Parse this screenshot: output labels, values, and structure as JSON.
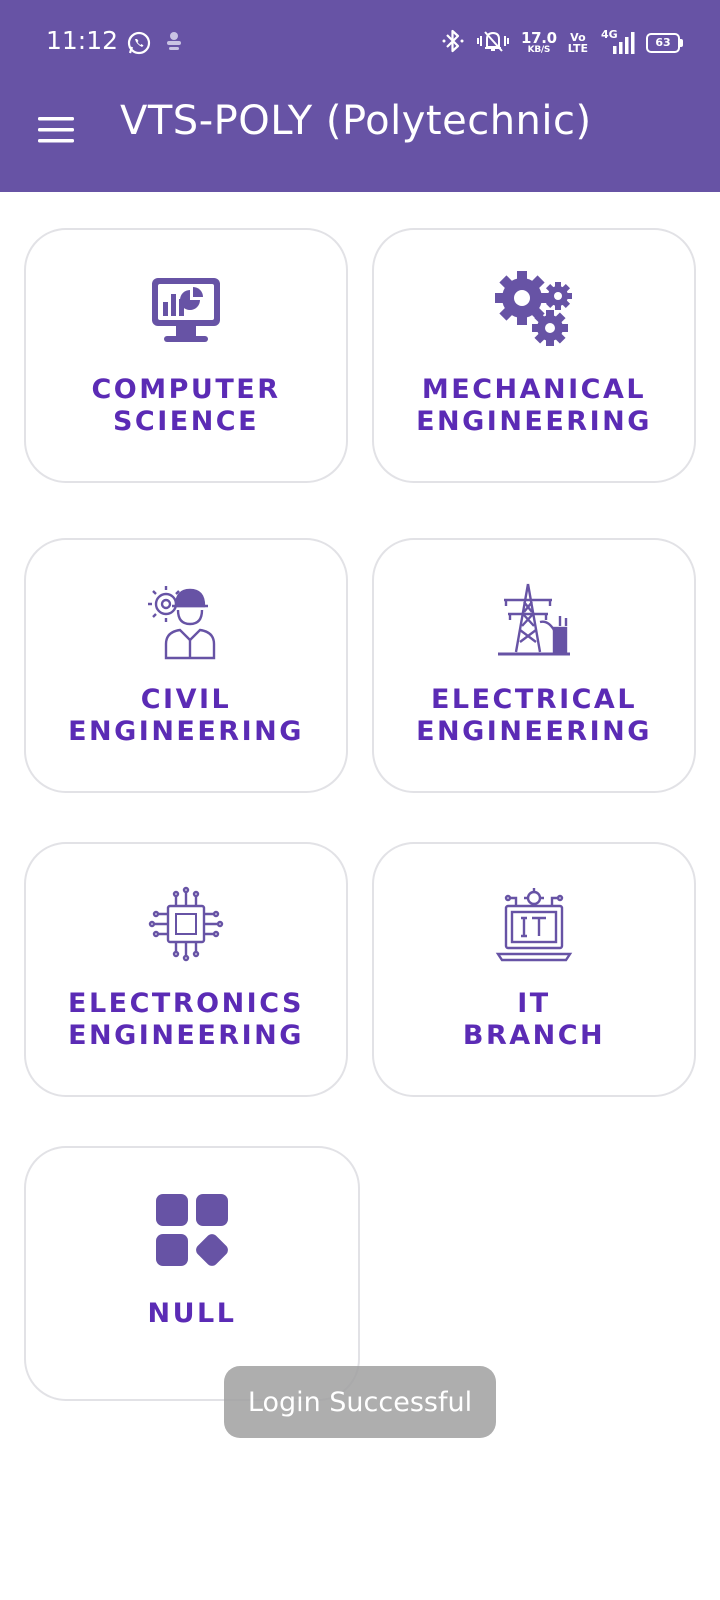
{
  "status_bar": {
    "time": "11:12",
    "net_speed_value": "17.0",
    "net_speed_unit": "KB/S",
    "volte_top": "Vo",
    "volte_bottom": "LTE",
    "network_type": "4G",
    "battery_level": "63",
    "left_icons": [
      "whatsapp-icon",
      "notification-app-icon"
    ],
    "right_icons": [
      "bluetooth-icon",
      "vibrate-mute-icon",
      "signal-icon",
      "battery-icon"
    ]
  },
  "app_bar": {
    "title": "VTS-POLY (Polytechnic)",
    "menu_icon": "hamburger-menu-icon",
    "background_color": "#6753a5"
  },
  "branches": [
    {
      "line1": "COMPUTER",
      "line2": "SCIENCE",
      "icon": "computer-dashboard-icon"
    },
    {
      "line1": "MECHANICAL",
      "line2": "ENGINEERING",
      "icon": "gears-icon"
    },
    {
      "line1": "CIVIL",
      "line2": "ENGINEERING",
      "icon": "engineer-worker-icon"
    },
    {
      "line1": "ELECTRICAL",
      "line2": "ENGINEERING",
      "icon": "power-tower-icon"
    },
    {
      "line1": "ELECTRONICS",
      "line2": "ENGINEERING",
      "icon": "microchip-icon"
    },
    {
      "line1": "IT",
      "line2": "BRANCH",
      "icon": "it-laptop-icon"
    },
    {
      "line1": "NULL",
      "line2": "",
      "icon": "apps-grid-icon"
    }
  ],
  "toast": {
    "message": "Login Successful"
  },
  "colors": {
    "accent": "#6753a5",
    "label": "#5b2bb5",
    "card_border": "#e2e2e6",
    "toast_bg": "#a0a0a0"
  }
}
